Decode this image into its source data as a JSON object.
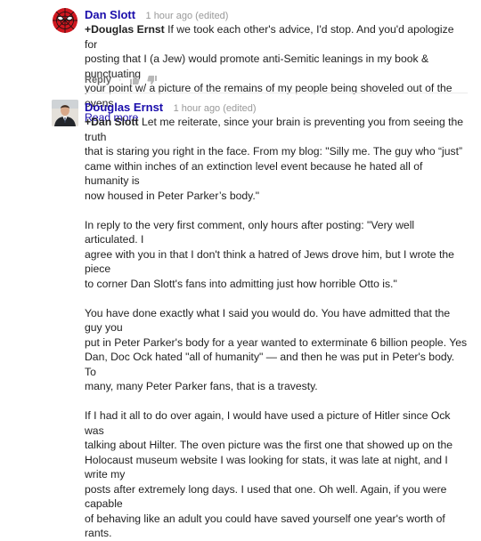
{
  "comments": [
    {
      "author": "Dan Slott",
      "time": "1 hour ago (edited)",
      "mention": "+Douglas Ernst",
      "lines": [
        "If we took each other's advice, I'd stop. And you'd apologize for",
        "posting that I (a Jew) would promote anti-Semitic leanings in my book & punctuating",
        "your point w/ a picture of the remains of my people being shoveled out of the ovens"
      ],
      "read_more": "Read more",
      "actions": {
        "reply": "Reply",
        "separator": "·"
      }
    },
    {
      "author": "Douglas Ernst",
      "time": "1 hour ago (edited)",
      "mention": "+Dan Slott",
      "paragraphs": [
        [
          "Let me reiterate, since your brain is preventing you from seeing the truth",
          "that is staring you right in the face. From my blog: \"Silly me. The guy who “just”",
          "came within inches of an extinction level event because he hated all of humanity is",
          "now housed in Peter Parker’s body.\""
        ],
        [
          "In reply to the very first comment, only hours after posting: \"Very well articulated. I",
          "agree with you in that I don't think a hatred of Jews drove him, but I wrote the piece",
          "to corner Dan Slott's fans into admitting just how horrible Otto is.\""
        ],
        [
          "You have done exactly what I said you would do. You have admitted that the guy you",
          "put in Peter Parker's body for a year wanted to exterminate 6 billion people. Yes",
          "Dan, Doc Ock hated \"all of humanity\" — and then he was put in Peter's body. To",
          "many, many Peter Parker fans, that is a travesty."
        ],
        [
          "If I had it all to do over again, I would have used a picture of Hitler since Ock was",
          "talking about Hilter. The oven picture was the first one that showed up on the",
          "Holocaust museum website I was looking for stats, it was late at night, and I write my",
          "posts after extremely long days. I used that one. Oh well. Again, if you were capable",
          "of behaving like an adult you could have saved yourself one year's worth of rants."
        ]
      ]
    }
  ]
}
